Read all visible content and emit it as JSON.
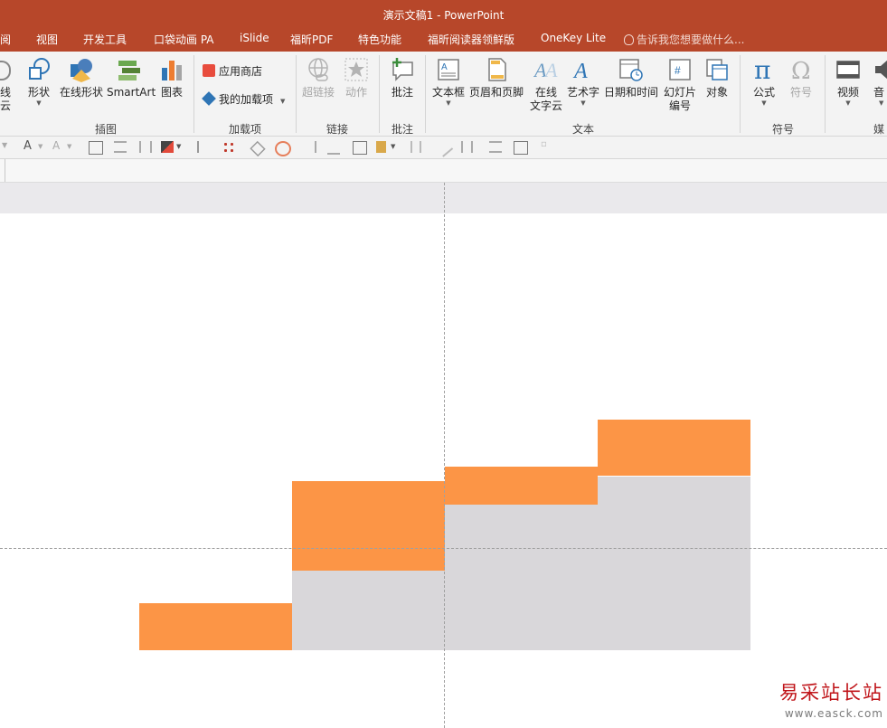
{
  "window": {
    "title": "演示文稿1 - PowerPoint"
  },
  "tabs": [
    "阅",
    "视图",
    "开发工具",
    "口袋动画 PA",
    "iSlide",
    "福昕PDF",
    "特色功能",
    "福昕阅读器领鲜版",
    "OneKey Lite"
  ],
  "tell_me": "告诉我您想要做什么...",
  "ribbon": {
    "partial_left": [
      "线",
      "云"
    ],
    "illustrations": {
      "shapes": "形状",
      "online_shapes": "在线形状",
      "smartart": "SmartArt",
      "chart": "图表",
      "group": "插图"
    },
    "addins": {
      "store": "应用商店",
      "my_addins": "我的加载项",
      "group": "加载项"
    },
    "links": {
      "hyperlink": "超链接",
      "action": "动作",
      "group": "链接"
    },
    "comments": {
      "comment": "批注",
      "group": "批注"
    },
    "text": {
      "textbox": "文本框",
      "header_footer": "页眉和页脚",
      "online_wordcloud_1": "在线",
      "online_wordcloud_2": "文字云",
      "wordart": "艺术字",
      "datetime": "日期和时间",
      "slide_number_1": "幻灯片",
      "slide_number_2": "编号",
      "object": "对象",
      "group": "文本"
    },
    "symbols": {
      "equation": "公式",
      "symbol": "符号",
      "group": "符号"
    },
    "media": {
      "video": "视频",
      "audio": "音",
      "group": "媒"
    }
  },
  "chart_data": {
    "type": "bar",
    "stacked": true,
    "categories": [
      "",
      "",
      "",
      ""
    ],
    "series": [
      {
        "values": [
          0,
          1.7,
          3.1,
          3.7
        ],
        "color": "#d9d7da"
      },
      {
        "values": [
          1,
          1.9,
          0.8,
          1.2
        ],
        "color": "#fc9546"
      }
    ],
    "grid": false
  },
  "watermark": {
    "text": "易采站长站",
    "url": "www.easck.com"
  },
  "colors": {
    "accent": "#b7472a",
    "orange": "#fc9546",
    "gray": "#d9d7da"
  }
}
